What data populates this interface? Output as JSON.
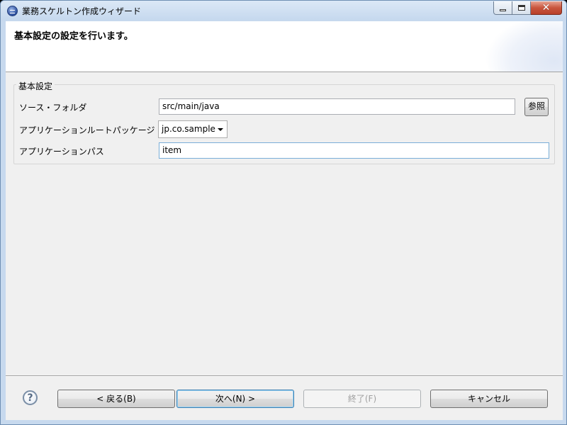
{
  "window": {
    "title": "業務スケルトン作成ウィザード",
    "close_glyph": "✕"
  },
  "header": {
    "title": "基本設定の設定を行います。"
  },
  "group": {
    "label": "基本設定",
    "source_folder": {
      "label": "ソース・フォルダ",
      "value": "src/main/java",
      "browse_label": "参照"
    },
    "root_package": {
      "label": "アプリケーションルートパッケージ",
      "selected": "jp.co.sample"
    },
    "app_path": {
      "label": "アプリケーションパス",
      "value": "item"
    }
  },
  "buttons": {
    "help": "?",
    "back": "< 戻る(B)",
    "next": "次へ(N) >",
    "finish": "終了(F)",
    "cancel": "キャンセル"
  }
}
